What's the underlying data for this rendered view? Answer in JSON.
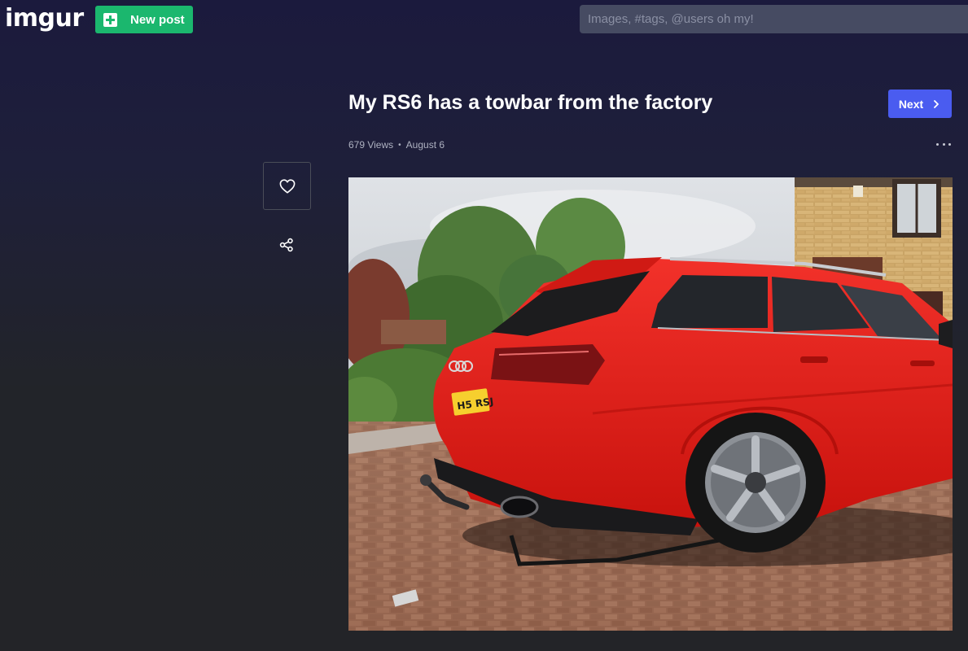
{
  "header": {
    "logo_text": "imgur",
    "new_post_label": "New post",
    "search_placeholder": "Images, #tags, @users oh my!"
  },
  "post": {
    "title": "My RS6 has a towbar from the factory",
    "views": "679 Views",
    "separator": "•",
    "date": "August 6",
    "next_label": "Next"
  },
  "photo": {
    "plate_text": "H5 RSJ"
  },
  "colors": {
    "new_post_green": "#1bb76e",
    "next_blue": "#4a5cf0",
    "car_red": "#e11a14"
  },
  "icons": {
    "like": "heart-icon",
    "share": "share-icon",
    "more": "more-dots-icon",
    "next": "chevron-right-icon",
    "new_post": "plus-icon"
  }
}
